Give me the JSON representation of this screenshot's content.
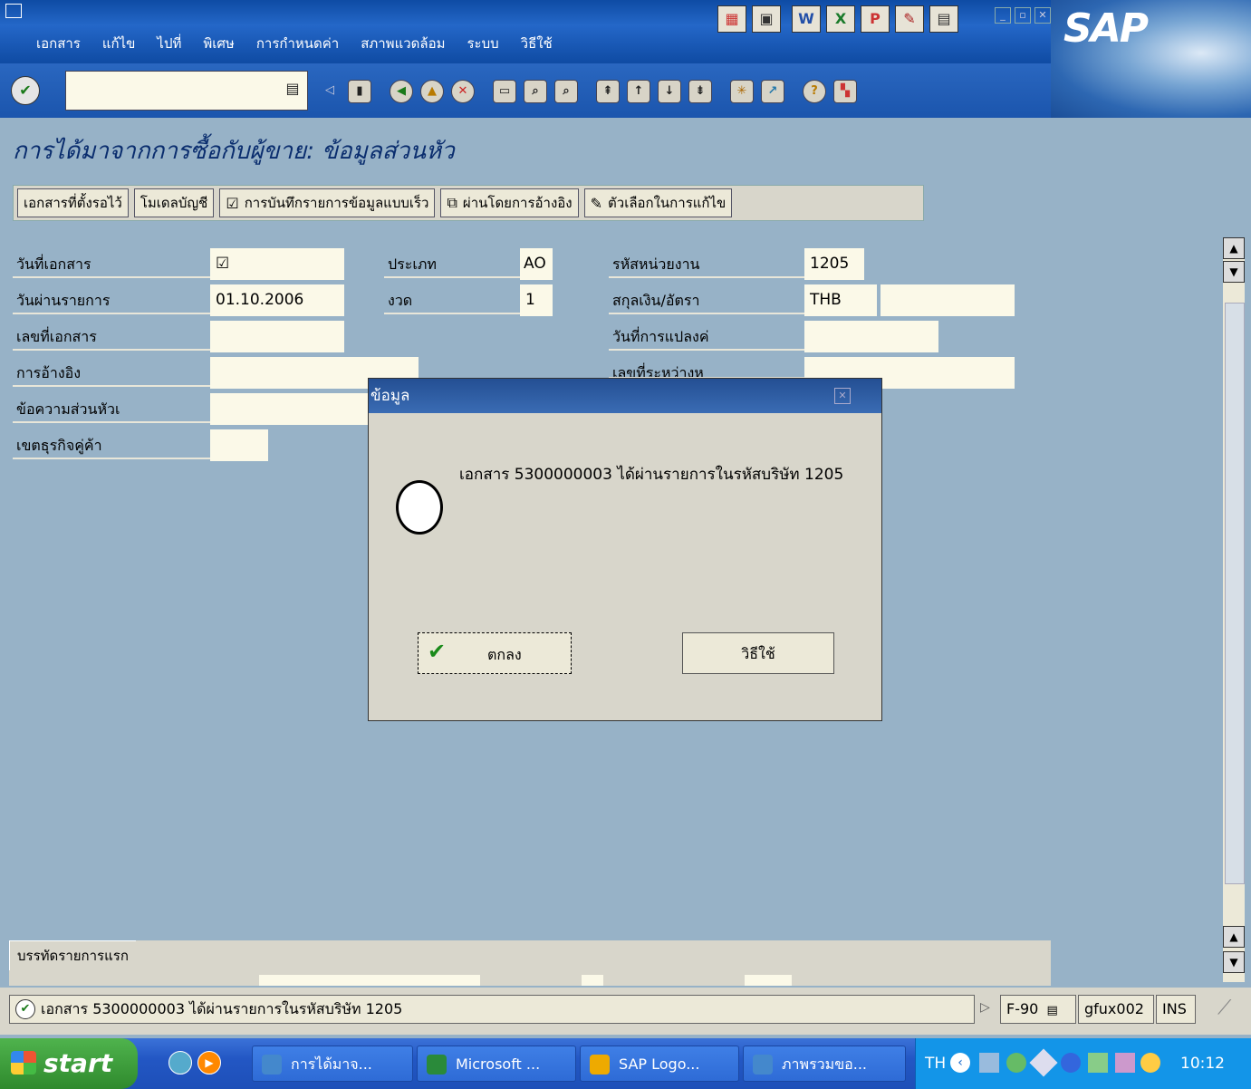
{
  "menu": [
    "เอกสาร",
    "แก้ไข",
    "ไปที่",
    "พิเศษ",
    "การกำหนดค่า",
    "สภาพแวดล้อม",
    "ระบบ",
    "วิธีใช้"
  ],
  "sap_logo": "SAP",
  "screen_title": "การได้มาจากการซื้อกับผู้ขาย: ข้อมูลส่วนหัว",
  "app_toolbar": {
    "parked": "เอกสารที่ตั้งรอไว้",
    "acct_model": "โมเดลบัญชี",
    "fast_entry": "การบันทึกรายการข้อมูลแบบเร็ว",
    "post_ref": "ผ่านโดยการอ้างอิง",
    "edit_options": "ตัวเลือกในการแก้ไข"
  },
  "form": {
    "doc_date_label": "วันที่เอกสาร",
    "doc_date_value": "☑",
    "posting_date_label": "วันผ่านรายการ",
    "posting_date_value": "01.10.2006",
    "doc_no_label": "เลขที่เอกสาร",
    "reference_label": "การอ้างอิง",
    "header_text_label": "ข้อความส่วนหัวเ",
    "trading_partner_label": "เขตธุรกิจคู่ค้า",
    "type_label": "ประเภท",
    "type_value": "AO",
    "period_label": "งวด",
    "period_value": "1",
    "company_code_label": "รหัสหน่วยงาน",
    "company_code_value": "1205",
    "currency_label": "สกุลเงิน/อัตรา",
    "currency_value": "THB",
    "translation_date_label": "วันที่การแปลงค่",
    "cross_cc_label": "เลขที่ระหว่างห"
  },
  "tab": {
    "label": "บรรทัดรายการแรก"
  },
  "dialog": {
    "title": "ข้อมูล",
    "message": "เอกสาร 5300000003 ได้ผ่านรายการในรหัสบริษัท 1205",
    "ok_label": "ตกลง",
    "help_label": "วิธีใช้"
  },
  "status": {
    "message": "เอกสาร 5300000003 ได้ผ่านรายการในรหัสบริษัท 1205",
    "tcode": "F-90",
    "server": "gfux002",
    "mode": "INS"
  },
  "taskbar": {
    "start": "start",
    "items": [
      "การได้มาจ...",
      "Microsoft ...",
      "SAP Logo...",
      "ภาพรวมขอ..."
    ],
    "lang": "TH",
    "clock": "10:12"
  }
}
